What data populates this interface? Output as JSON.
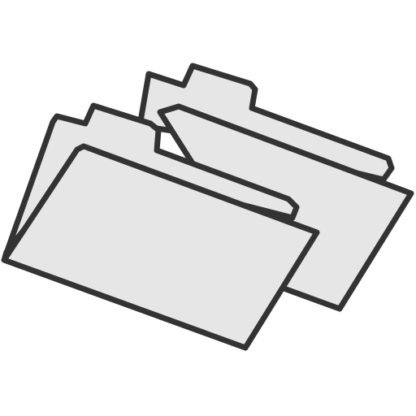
{
  "icon": {
    "name": "folders-icon",
    "fill_color": "#e6e6e6",
    "stroke_color": "#333333"
  }
}
